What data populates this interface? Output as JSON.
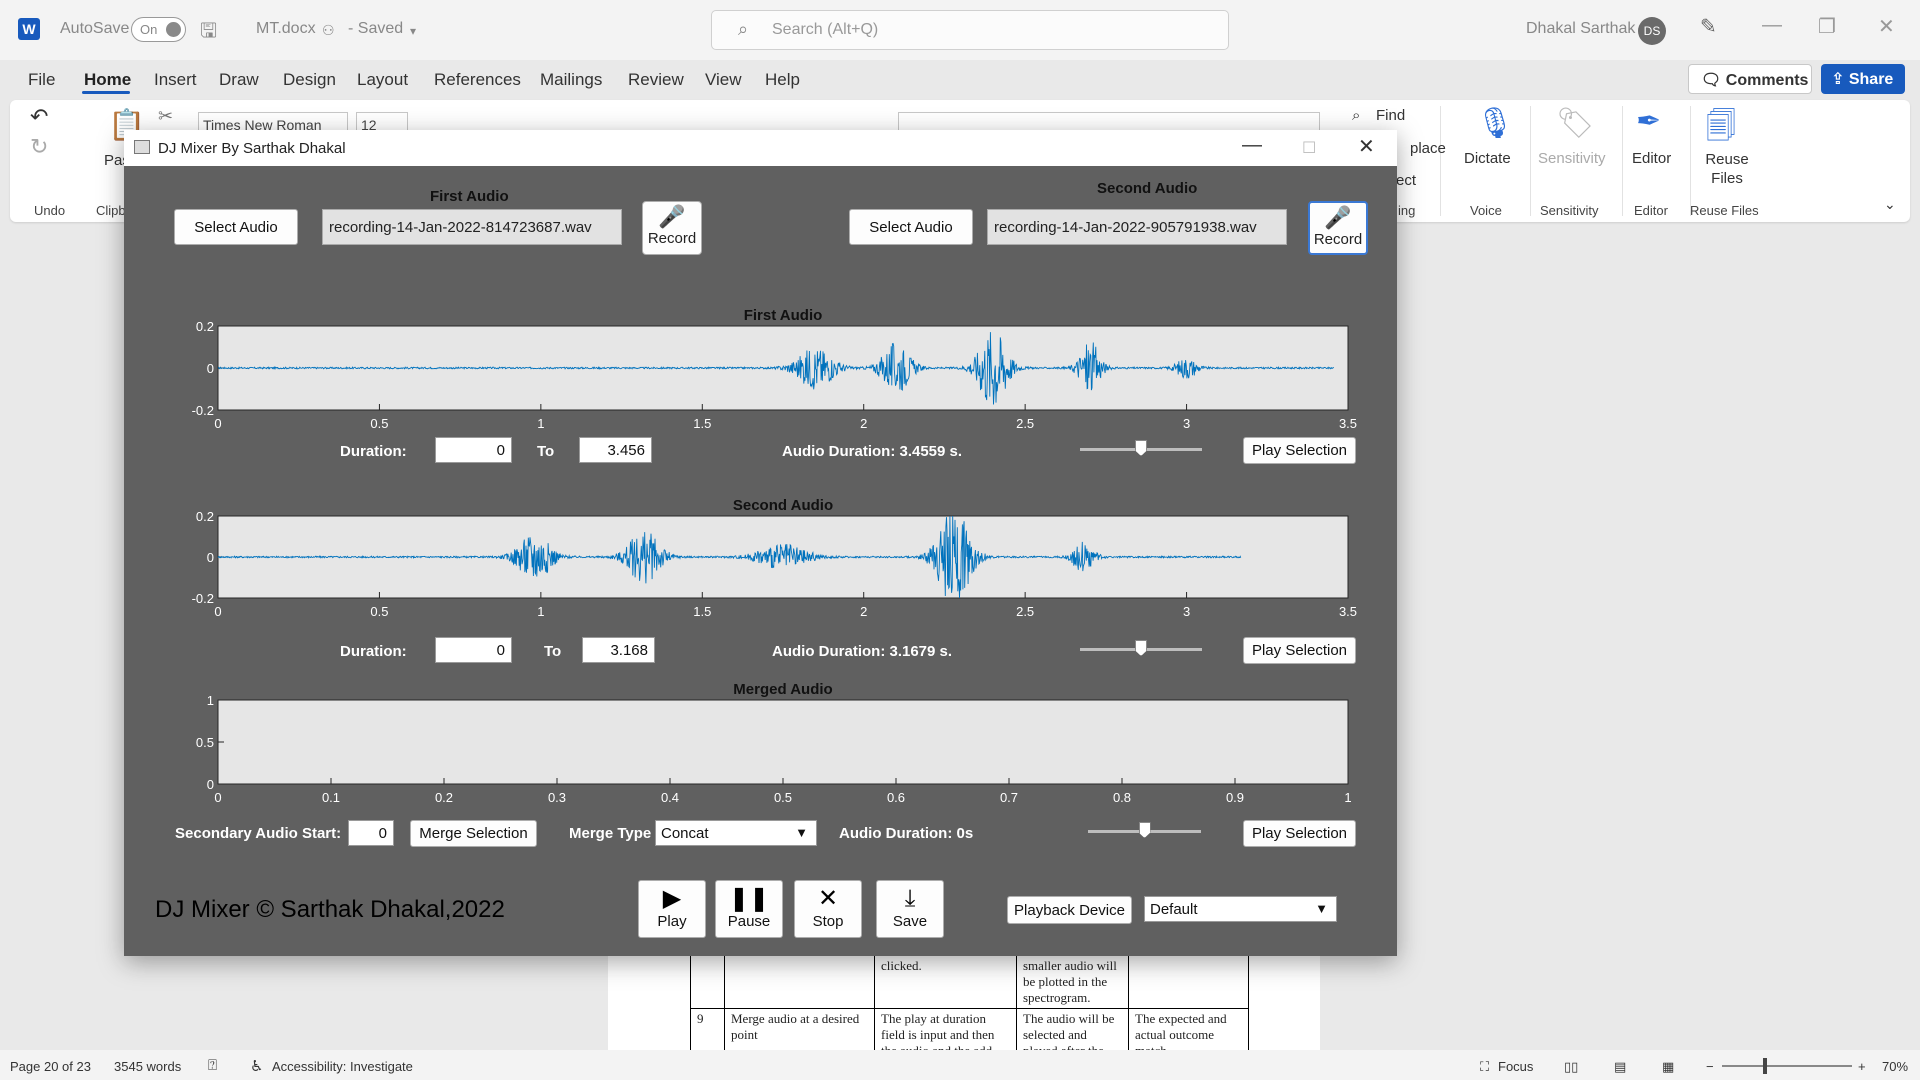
{
  "word": {
    "autosave_label": "AutoSave",
    "autosave_state": "On",
    "doc_name": "MT.docx",
    "saved_state": "- Saved",
    "search_placeholder": "Search (Alt+Q)",
    "user_name": "Dhakal Sarthak",
    "user_initials": "DS",
    "tabs": [
      "File",
      "Home",
      "Insert",
      "Draw",
      "Design",
      "Layout",
      "References",
      "Mailings",
      "Review",
      "View",
      "Help"
    ],
    "comments_label": "Comments",
    "share_label": "Share",
    "ribbon": {
      "font_name": "Times New Roman",
      "font_size": "12",
      "find_label": "Find",
      "replace_label": "place",
      "select_label": "ect",
      "dictate_label": "Dictate",
      "sensitivity_label": "Sensitivity",
      "editor_label": "Editor",
      "reuse_label": "Reuse Files",
      "paste_label": "Pas",
      "groups": {
        "undo": "Undo",
        "clipboard": "Clipb",
        "editing": "ing",
        "voice": "Voice",
        "sensitivity": "Sensitivity",
        "editor": "Editor",
        "reuse": "Reuse Files"
      }
    },
    "status": {
      "page": "Page 20 of 23",
      "words": "3545 words",
      "accessibility": "Accessibility: Investigate",
      "focus": "Focus",
      "zoom": "70%"
    },
    "doc_table": [
      [
        "",
        "",
        "clicked.",
        "smaller audio will be plotted in the spectrogram.",
        ""
      ],
      [
        "9",
        "Merge audio at a desired point",
        "The play at duration field is input and then the audio and the add",
        "The audio will be selected and played after the",
        "The expected and actual outcome match"
      ]
    ]
  },
  "mixer": {
    "window_title": "DJ Mixer By Sarthak Dhakal",
    "first": {
      "section_label": "First Audio",
      "select_label": "Select Audio",
      "file_name": "recording-14-Jan-2022-814723687.wav",
      "record_label": "Record",
      "plot_title": "First Audio",
      "duration_label": "Duration:",
      "from": "0",
      "to_label": "To",
      "to": "3.456",
      "audio_duration": "Audio Duration: 3.4559 s.",
      "slider_value": 0.5,
      "play_label": "Play Selection"
    },
    "second": {
      "section_label": "Second Audio",
      "select_label": "Select Audio",
      "file_name": "recording-14-Jan-2022-905791938.wav",
      "record_label": "Record",
      "plot_title": "Second Audio",
      "duration_label": "Duration:",
      "from": "0",
      "to_label": "To",
      "to": "3.168",
      "audio_duration": "Audio Duration: 3.1679 s.",
      "slider_value": 0.5,
      "play_label": "Play Selection"
    },
    "merged": {
      "plot_title": "Merged Audio",
      "secondary_start_label": "Secondary Audio Start:",
      "secondary_start": "0",
      "merge_label": "Merge Selection",
      "merge_type_label": "Merge Type",
      "merge_type": "Concat",
      "audio_duration": "Audio Duration: 0s",
      "slider_value": 0.5,
      "play_label": "Play Selection"
    },
    "controls": {
      "play": "Play",
      "pause": "Pause",
      "stop": "Stop",
      "save": "Save",
      "playback_device_label": "Playback Device",
      "playback_device": "Default"
    },
    "copyright": "DJ Mixer © Sarthak Dhakal,2022",
    "colors": {
      "waveform": "#0072bd",
      "panel_bg": "#606060",
      "axes_bg": "#e6e6e6"
    }
  },
  "chart_data": [
    {
      "type": "line",
      "title": "First Audio",
      "xlim": [
        0,
        3.5
      ],
      "ylim": [
        -0.2,
        0.2
      ],
      "xticks": [
        0,
        0.5,
        1,
        1.5,
        2,
        2.5,
        3,
        3.5
      ],
      "yticks": [
        -0.2,
        0,
        0.2
      ],
      "bursts": [
        {
          "t": 1.85,
          "amp": 0.1,
          "width": 0.09
        },
        {
          "t": 2.1,
          "amp": 0.12,
          "width": 0.07
        },
        {
          "t": 2.4,
          "amp": 0.2,
          "width": 0.07
        },
        {
          "t": 2.7,
          "amp": 0.13,
          "width": 0.05
        },
        {
          "t": 3.0,
          "amp": 0.05,
          "width": 0.05
        }
      ],
      "signal_end": 3.456
    },
    {
      "type": "line",
      "title": "Second Audio",
      "xlim": [
        0,
        3.5
      ],
      "ylim": [
        -0.2,
        0.2
      ],
      "xticks": [
        0,
        0.5,
        1,
        1.5,
        2,
        2.5,
        3,
        3.5
      ],
      "yticks": [
        -0.2,
        0,
        0.2
      ],
      "bursts": [
        {
          "t": 0.98,
          "amp": 0.12,
          "width": 0.08
        },
        {
          "t": 1.32,
          "amp": 0.13,
          "width": 0.08
        },
        {
          "t": 1.75,
          "amp": 0.06,
          "width": 0.12
        },
        {
          "t": 2.28,
          "amp": 0.24,
          "width": 0.08
        },
        {
          "t": 2.68,
          "amp": 0.08,
          "width": 0.05
        }
      ],
      "signal_end": 3.168
    },
    {
      "type": "line",
      "title": "Merged Audio",
      "xlim": [
        0,
        1
      ],
      "ylim": [
        0,
        1
      ],
      "xticks": [
        0,
        0.1,
        0.2,
        0.3,
        0.4,
        0.5,
        0.6,
        0.7,
        0.8,
        0.9,
        1
      ],
      "yticks": [
        0,
        0.5,
        1
      ],
      "bursts": [],
      "signal_end": 0
    }
  ]
}
